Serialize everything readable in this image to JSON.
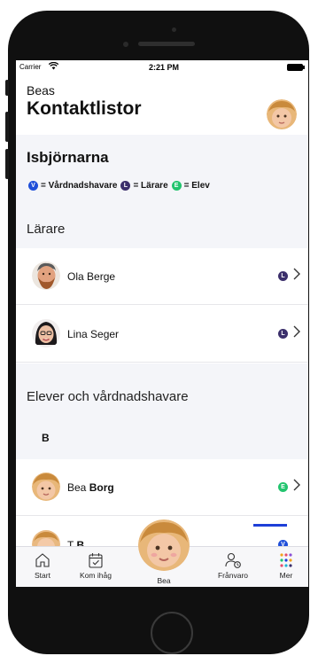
{
  "statusbar": {
    "carrier": "Carrier",
    "time": "2:21 PM"
  },
  "header": {
    "subtitle": "Beas",
    "title": "Kontaktlistor"
  },
  "class_block": {
    "name": "Isbjörnarna",
    "legend": [
      {
        "letter": "V",
        "label": "= Vårdnadshavare",
        "color": "#1f4fd9"
      },
      {
        "letter": "L",
        "label": "= Lärare",
        "color": "#3b2f6b"
      },
      {
        "letter": "E",
        "label": "= Elev",
        "color": "#22c46e"
      }
    ]
  },
  "teachers": {
    "title": "Lärare",
    "rows": [
      {
        "first": "Ola",
        "last": "Berge",
        "badge": "L"
      },
      {
        "first": "Lina",
        "last": "Seger",
        "badge": "L"
      }
    ]
  },
  "students": {
    "title": "Elever och vårdnadshavare",
    "letter": "B",
    "rows": [
      {
        "first": "Bea",
        "last": "Borg",
        "badge": "E"
      },
      {
        "first": "T",
        "last": "B",
        "badge": "V"
      }
    ]
  },
  "tabbar": {
    "tabs": [
      {
        "label": "Start",
        "icon": "home-icon"
      },
      {
        "label": "Kom ihåg",
        "icon": "calendar-check-icon"
      },
      {
        "label": "Bea",
        "icon": "child-avatar"
      },
      {
        "label": "Frånvaro",
        "icon": "person-clock-icon"
      },
      {
        "label": "Mer",
        "icon": "grid-dots-icon"
      }
    ],
    "active": "Mer",
    "accent": "#1e3fd8"
  }
}
